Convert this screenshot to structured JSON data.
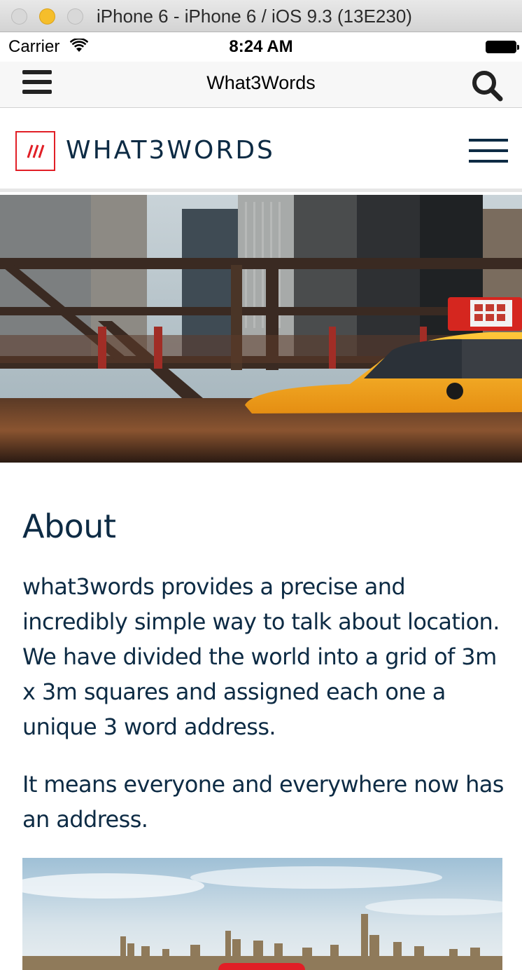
{
  "window": {
    "title": "iPhone 6 - iPhone 6 / iOS 9.3 (13E230)"
  },
  "status_bar": {
    "carrier": "Carrier",
    "time": "8:24 AM"
  },
  "navbar": {
    "title": "What3Words"
  },
  "site": {
    "logo_text": "WHAT3WORDS",
    "logo_mark": "///",
    "brand_color": "#e11f26",
    "text_color": "#0d2b44"
  },
  "content": {
    "heading": "About",
    "paragraphs": [
      "what3words provides a precise and incredibly simple way to talk about location. We have divided the world into a grid of 3m x 3m squares and assigned each one a unique 3 word address.",
      "It means everyone and everywhere now has an address."
    ]
  },
  "icons": [
    "hamburger-menu-icon",
    "search-icon",
    "wifi-icon",
    "battery-icon",
    "site-menu-icon"
  ]
}
